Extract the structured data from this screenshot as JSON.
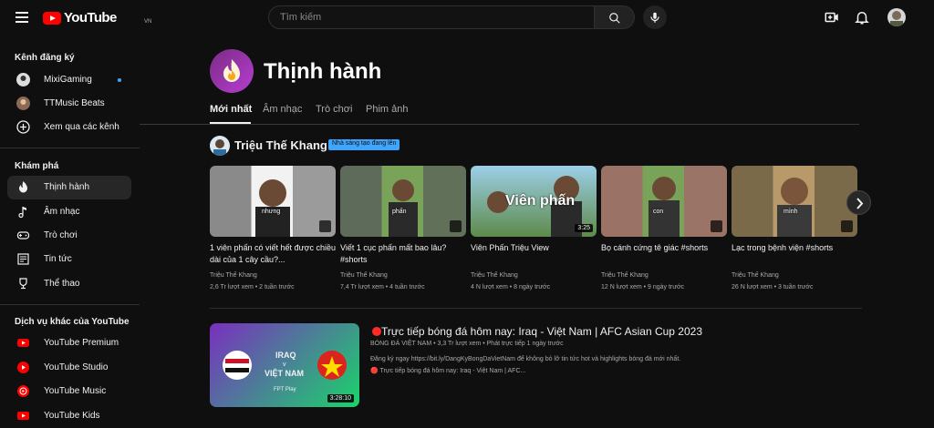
{
  "header": {
    "logo_text": "YouTube",
    "country_code": "VN",
    "search_placeholder": "Tìm kiếm"
  },
  "sidebar": {
    "subscriptions_title": "Kênh đăng ký",
    "subscriptions": [
      {
        "label": "MixiGaming"
      },
      {
        "label": "TTMusic Beats"
      },
      {
        "label": "Xem qua các kênh"
      }
    ],
    "explore_title": "Khám phá",
    "explore": [
      {
        "label": "Thịnh hành"
      },
      {
        "label": "Âm nhạc"
      },
      {
        "label": "Trò chơi"
      },
      {
        "label": "Tin tức"
      },
      {
        "label": "Thể thao"
      }
    ],
    "more_title": "Dịch vụ khác của YouTube",
    "more": [
      {
        "label": "YouTube Premium"
      },
      {
        "label": "YouTube Studio"
      },
      {
        "label": "YouTube Music"
      },
      {
        "label": "YouTube Kids"
      }
    ]
  },
  "page": {
    "title": "Thịnh hành",
    "tabs": [
      "Mới nhất",
      "Âm nhạc",
      "Trò chơi",
      "Phim ảnh"
    ]
  },
  "creator": {
    "name": "Triệu Thế Khang",
    "badge": "Nhà sáng tạo đang lên"
  },
  "videos": [
    {
      "title": "1 viên phấn có viết hết được chiều dài của 1 cây cầu?...",
      "channel": "Triệu Thế Khang",
      "meta": "2,6 Tr lượt xem • 2 tuần trước",
      "thumb_text": "nhưng",
      "short": true
    },
    {
      "title": "Viết 1 cục phấn mất bao lâu? #shorts",
      "channel": "Triệu Thế Khang",
      "meta": "7,4 Tr lượt xem • 4 tuần trước",
      "thumb_text": "phấn",
      "short": true
    },
    {
      "title": "Viên Phấn Triệu View",
      "channel": "Triệu Thế Khang",
      "meta": "4 N lượt xem • 8 ngày trước",
      "thumb_text": "Viên phấn",
      "duration": "3:25",
      "short": false
    },
    {
      "title": "Bọ cánh cứng tê giác #shorts",
      "channel": "Triệu Thế Khang",
      "meta": "12 N lượt xem • 9 ngày trước",
      "thumb_text": "con",
      "short": true
    },
    {
      "title": "Lạc trong bệnh viện #shorts",
      "channel": "Triệu Thế Khang",
      "meta": "26 N lượt xem • 3 tuần trước",
      "thumb_text": "mình",
      "short": true
    }
  ],
  "live_video": {
    "title": "Trực tiếp bóng đá hôm nay: Iraq - Việt Nam | AFC Asian Cup 2023",
    "channel_meta": "BÓNG ĐÁ VIỆT NAM • 3,3 Tr lượt xem • Phát trực tiếp 1 ngày trước",
    "description_line1": "Đăng ký ngay https://bit.ly/DangKyBongDaVietNam để không bỏ lỡ tin tức hot và highlights bóng đá mới nhất.",
    "description_line2": "🔴 Trực tiếp bóng đá hôm nay: Iraq - Việt Nam | AFC...",
    "duration": "3:28:10",
    "thumb_team1": "IRAQ",
    "thumb_vs": "v",
    "thumb_team2": "VIỆT NAM",
    "thumb_broadcaster": "FPT Play"
  },
  "colors": {
    "accent_blue": "#3ea6ff",
    "youtube_red": "#ff0000"
  }
}
